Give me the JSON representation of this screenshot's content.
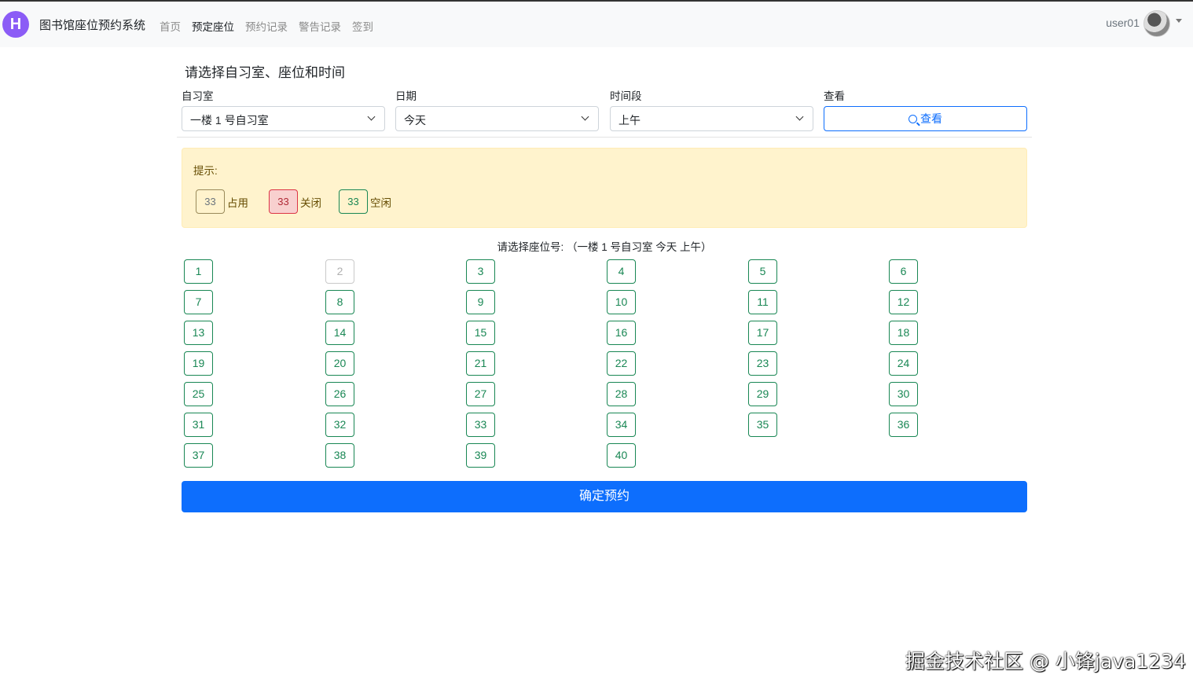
{
  "navbar": {
    "logo_letter": "H",
    "brand": "图书馆座位预约系统",
    "items": [
      {
        "label": "首页",
        "active": false
      },
      {
        "label": "预定座位",
        "active": true
      },
      {
        "label": "预约记录",
        "active": false
      },
      {
        "label": "警告记录",
        "active": false
      },
      {
        "label": "签到",
        "active": false
      }
    ],
    "username": "user01"
  },
  "form": {
    "heading": "请选择自习室、座位和时间",
    "room_label": "自习室",
    "room_value": "一楼 1 号自习室",
    "date_label": "日期",
    "date_value": "今天",
    "period_label": "时间段",
    "period_value": "上午",
    "view_label": "查看",
    "view_button": "查看"
  },
  "tips": {
    "title": "提示:",
    "legend": [
      {
        "number": "33",
        "text": "占用",
        "status": "occupied"
      },
      {
        "number": "33",
        "text": "关闭",
        "status": "closed"
      },
      {
        "number": "33",
        "text": "空闲",
        "status": "free"
      }
    ]
  },
  "seats": {
    "heading": "请选择座位号: （一楼 1 号自习室 今天 上午）",
    "list": [
      {
        "n": "1",
        "s": "free"
      },
      {
        "n": "2",
        "s": "disabled"
      },
      {
        "n": "3",
        "s": "free"
      },
      {
        "n": "4",
        "s": "free"
      },
      {
        "n": "5",
        "s": "free"
      },
      {
        "n": "6",
        "s": "free"
      },
      {
        "n": "7",
        "s": "free"
      },
      {
        "n": "8",
        "s": "free"
      },
      {
        "n": "9",
        "s": "free"
      },
      {
        "n": "10",
        "s": "free"
      },
      {
        "n": "11",
        "s": "free"
      },
      {
        "n": "12",
        "s": "free"
      },
      {
        "n": "13",
        "s": "free"
      },
      {
        "n": "14",
        "s": "free"
      },
      {
        "n": "15",
        "s": "free"
      },
      {
        "n": "16",
        "s": "free"
      },
      {
        "n": "17",
        "s": "free"
      },
      {
        "n": "18",
        "s": "free"
      },
      {
        "n": "19",
        "s": "free"
      },
      {
        "n": "20",
        "s": "free"
      },
      {
        "n": "21",
        "s": "free"
      },
      {
        "n": "22",
        "s": "free"
      },
      {
        "n": "23",
        "s": "free"
      },
      {
        "n": "24",
        "s": "free"
      },
      {
        "n": "25",
        "s": "free"
      },
      {
        "n": "26",
        "s": "free"
      },
      {
        "n": "27",
        "s": "free"
      },
      {
        "n": "28",
        "s": "free"
      },
      {
        "n": "29",
        "s": "free"
      },
      {
        "n": "30",
        "s": "free"
      },
      {
        "n": "31",
        "s": "free"
      },
      {
        "n": "32",
        "s": "free"
      },
      {
        "n": "33",
        "s": "free"
      },
      {
        "n": "34",
        "s": "free"
      },
      {
        "n": "35",
        "s": "free"
      },
      {
        "n": "36",
        "s": "free"
      },
      {
        "n": "37",
        "s": "free"
      },
      {
        "n": "38",
        "s": "free"
      },
      {
        "n": "39",
        "s": "free"
      },
      {
        "n": "40",
        "s": "free"
      }
    ]
  },
  "confirm_button": "确定预约",
  "watermark": "掘金技术社区 @ 小锋java1234",
  "colors": {
    "primary": "#0d6efd",
    "success": "#198754",
    "danger": "#dc3545",
    "warning_bg": "#fff3cd",
    "logo": "#8b5cf6"
  }
}
